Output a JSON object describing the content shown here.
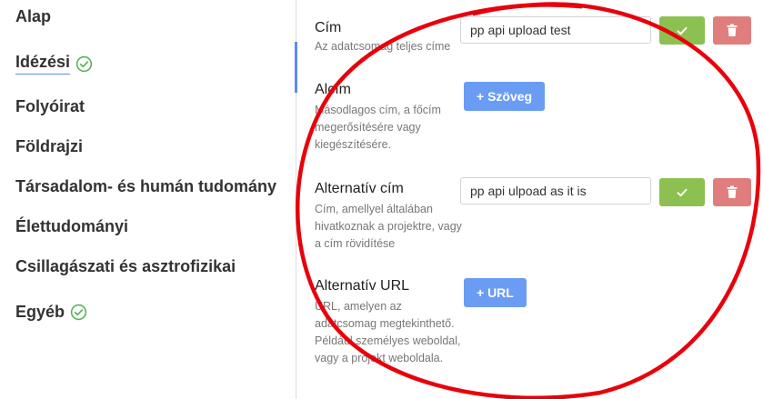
{
  "sidebar": {
    "items": [
      {
        "label": "Alap",
        "checked": false
      },
      {
        "label": "Idézési",
        "checked": true,
        "active": true
      },
      {
        "label": "Folyóirat",
        "checked": false
      },
      {
        "label": "Földrajzi",
        "checked": false
      },
      {
        "label": "Társadalom- és humán tudomány",
        "checked": false
      },
      {
        "label": "Élettudományi",
        "checked": false
      },
      {
        "label": "Csillagászati és asztrofizikai",
        "checked": false
      },
      {
        "label": "Egyéb",
        "checked": true
      }
    ]
  },
  "fields": {
    "cim": {
      "title": "Cím",
      "description": "Az adatcsomag teljes címe",
      "value": "pp api upload test"
    },
    "alcim": {
      "title": "Alcím",
      "description": "Másodlagos cím, a főcím megerősítésére vagy kiegészítésére.",
      "add_label": "+ Szöveg"
    },
    "alternativ_cim": {
      "title": "Alternatív cím",
      "description": "Cím, amellyel általában hivatkoznak a projektre, vagy a cím rövidítése",
      "value": "pp api ulpoad as it is"
    },
    "alternativ_url": {
      "title": "Alternatív URL",
      "description": "URL, amelyen az adatcsomag megtekinthető. Például személyes weboldal, vagy a projekt weboldala.",
      "add_label": "+ URL"
    }
  },
  "colors": {
    "accent": "#5b8def",
    "success": "#8cc152",
    "danger": "#df7e7c",
    "annotation": "#e8000b"
  },
  "icons": {
    "ok": "check-icon",
    "delete": "trash-icon",
    "status": "check-circle-icon"
  }
}
